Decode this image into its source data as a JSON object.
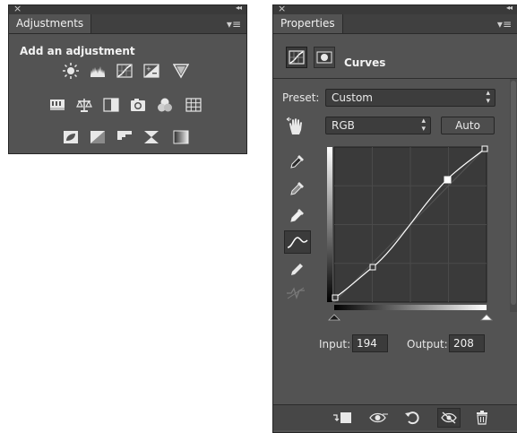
{
  "adjustments": {
    "close_glyph": "×",
    "collapse_glyph": "◂◂",
    "tab_label": "Adjustments",
    "menu_glyph": "▾≡",
    "heading": "Add an adjustment"
  },
  "properties": {
    "close_glyph": "×",
    "collapse_glyph": "◂◂",
    "tab_label": "Properties",
    "menu_glyph": "▾≡",
    "panel_title": "Curves",
    "preset_label": "Preset:",
    "preset_value": "Custom",
    "channel_value": "RGB",
    "auto_label": "Auto",
    "input_label": "Input:",
    "input_value": "194",
    "output_label": "Output:",
    "output_value": "208",
    "select_arrows": "⌃⌄"
  },
  "colors": {
    "panel_bg": "#535353",
    "titlebar_bg": "#3a3a3a",
    "text": "#e6e6e6",
    "curve_line": "#ffffff"
  }
}
